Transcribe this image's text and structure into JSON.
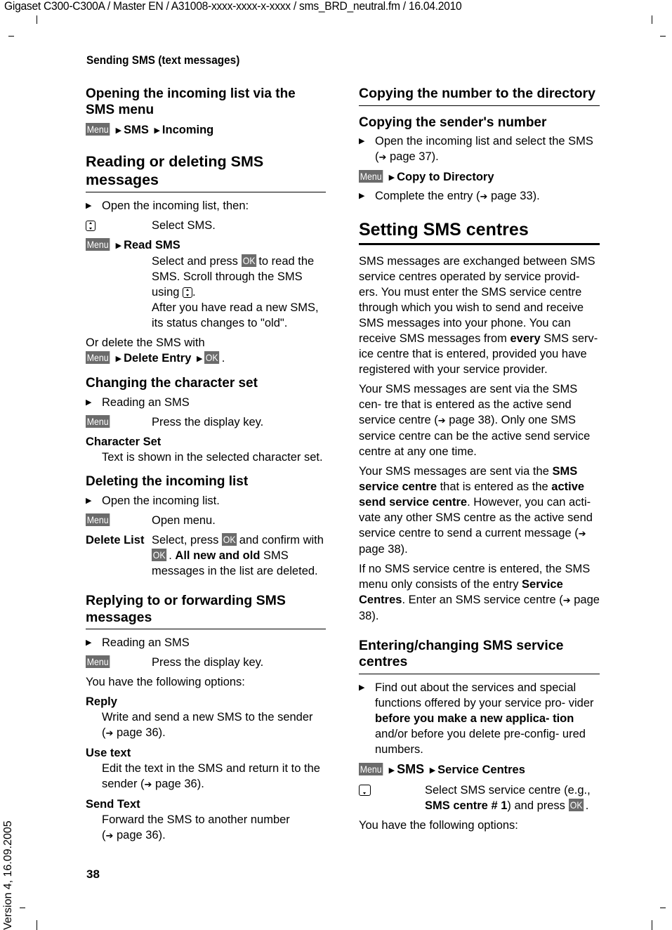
{
  "doc_header": "Gigaset C300-C300A / Master EN / A31008-xxxx-xxxx-x-xxxx / sms_BRD_neutral.fm / 16.04.2010",
  "section_title": "Sending SMS (text messages)",
  "page_number": "38",
  "version_note": "Version 4, 16.09.2005",
  "keys": {
    "menu": "Menu",
    "ok": "OK"
  },
  "ref": {
    "arrow": "➔",
    "page36": "page 36",
    "page37": "page 37",
    "page33": "page 33",
    "page38": "page 38"
  },
  "left": {
    "opening": {
      "title": "Opening the incoming list via the SMS menu",
      "path": [
        "SMS",
        "Incoming"
      ]
    },
    "reading": {
      "title": "Reading or deleting SMS messages",
      "bullet": "Open the incoming list, then:",
      "select_sms": "Select SMS.",
      "read_sms_path": "Read SMS",
      "read_desc_1": "Select and press",
      "read_desc_2": "to read the SMS. Scroll through the SMS using",
      "read_desc_3": ".",
      "read_desc_4": "After you have read a new SMS, its status changes to \"old\".",
      "delete_intro": "Or delete the SMS with",
      "delete_path": "Delete Entry",
      "delete_end": "."
    },
    "charset": {
      "title": "Changing the character set",
      "bullet": "Reading an SMS",
      "menu_desc": "Press the display key.",
      "option_title": "Character Set",
      "option_desc": "Text is shown in the selected character set."
    },
    "delete_list": {
      "title": "Deleting the incoming list",
      "bullet": "Open the incoming list.",
      "menu_desc": "Open menu.",
      "key_label": "Delete List",
      "desc_1": "Select, press",
      "desc_2": "and confirm with",
      "desc_3": ".",
      "desc_bold": "All new and old",
      "desc_4": "SMS messages in the list are deleted."
    },
    "reply": {
      "title": "Replying to or forwarding SMS messages",
      "bullet": "Reading an SMS",
      "menu_desc": "Press the display key.",
      "options_intro": "You have the following options:",
      "options": [
        {
          "title": "Reply",
          "desc": "Write and send a new SMS to the sender",
          "ref": "page 36"
        },
        {
          "title": "Use text",
          "desc": "Edit the text in the SMS and return it to the sender",
          "ref": "page 36"
        },
        {
          "title": "Send Text",
          "desc": "Forward the SMS to another number",
          "ref": "page 36"
        }
      ]
    }
  },
  "right": {
    "copy": {
      "title": "Copying the number to the directory",
      "subtitle": "Copying the sender's number",
      "bullet1": "Open the incoming list and select the SMS (",
      "bullet1_ref": "page 37",
      "path": "Copy to Directory",
      "bullet2": "Complete the entry (",
      "bullet2_ref": "page 33"
    },
    "centres": {
      "title": "Setting SMS centres",
      "p1_a": "SMS messages are exchanged between SMS service centres operated by service provid- ers. You must enter the SMS service centre through which you wish to send and receive SMS messages into your phone. You can receive SMS messages from",
      "p1_bold": "every",
      "p1_b": "SMS serv- ice centre that is entered, provided you have registered with your service provider.",
      "p2_a": "Your SMS messages are sent via the SMS cen- tre that is entered as the active send service centre (",
      "p2_ref": "page 38",
      "p2_b": "). Only one SMS service centre can be the active send service centre at any one time.",
      "p3_a": "Your SMS messages are sent via the",
      "p3_bold1": "SMS service centre",
      "p3_b": "that is entered as the",
      "p3_bold2": "active send service centre",
      "p3_c": ". However, you can acti- vate any other SMS centre as the active send service centre to send a current message (",
      "p3_ref": "page 38",
      "p3_d": ").",
      "p4_a": "If no SMS service centre is entered, the SMS menu only consists of the entry",
      "p4_bold": "Service Centres",
      "p4_b": ". Enter an SMS service centre (",
      "p4_ref": "page 38",
      "p4_c": ")."
    },
    "entering": {
      "title": "Entering/changing SMS service centres",
      "bullet_a": "Find out about the services and special functions offered by your service pro- vider",
      "bullet_bold": "before you make a new applica- tion",
      "bullet_b": "and/or before you delete pre-config- ured numbers.",
      "path": [
        "SMS",
        "Service Centres"
      ],
      "select_a": "Select SMS service centre (e.g.,",
      "select_bold": "SMS centre # 1",
      "select_b": ") and press",
      "select_c": ".",
      "options_intro": "You have the following options:"
    }
  }
}
